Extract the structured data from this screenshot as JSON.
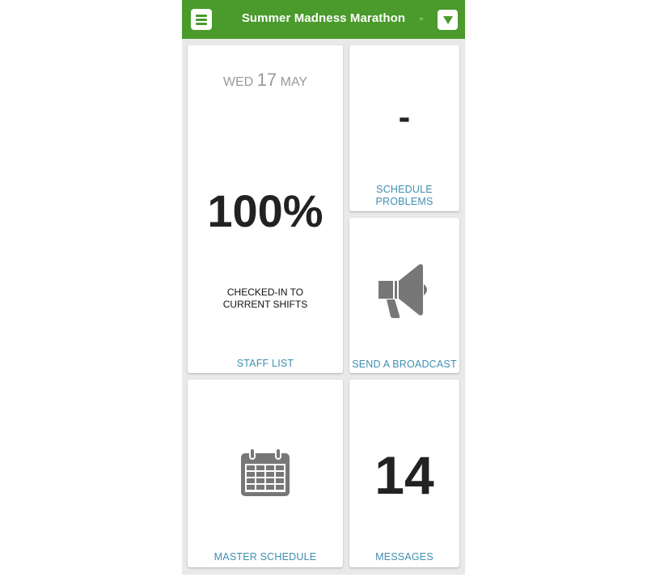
{
  "header": {
    "title": "Summer Madness Marathon",
    "menu_icon": "hamburger-menu-icon",
    "dropdown_icon": "triangle-down-icon"
  },
  "colors": {
    "header_green": "#4a9a2c",
    "link_blue": "#3f8fb0",
    "icon_gray": "#777777"
  },
  "staff_tile": {
    "weekday": "WED",
    "day": "17",
    "month": "MAY",
    "percent": "100%",
    "caption_line1": "CHECKED-IN TO",
    "caption_line2": "CURRENT SHIFTS",
    "link": "STAFF LIST"
  },
  "problems_tile": {
    "value": "-",
    "link_line1": "SCHEDULE",
    "link_line2": "PROBLEMS"
  },
  "broadcast_tile": {
    "icon": "megaphone-icon",
    "link": "SEND A BROADCAST"
  },
  "schedule_tile": {
    "icon": "calendar-icon",
    "link": "MASTER SCHEDULE"
  },
  "messages_tile": {
    "count": "14",
    "link": "MESSAGES"
  }
}
